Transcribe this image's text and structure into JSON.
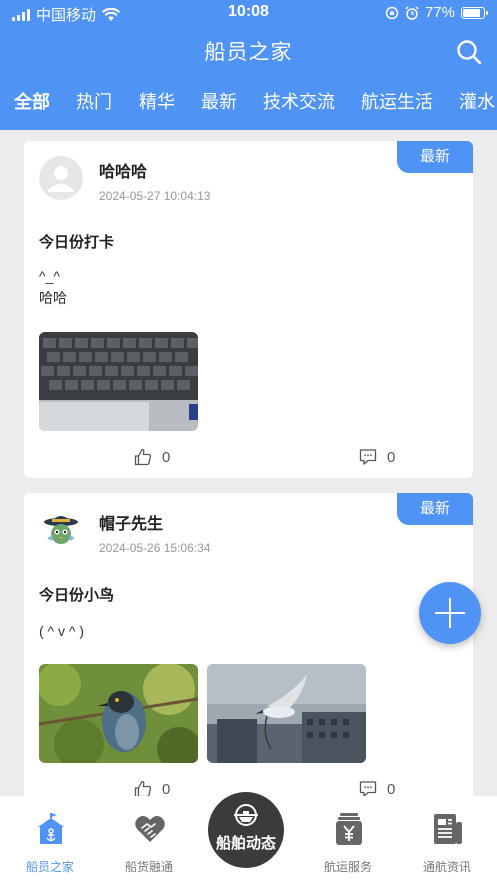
{
  "status_bar": {
    "carrier": "中国移动",
    "time": "10:08",
    "battery": "77%",
    "battery_level": 0.77
  },
  "header": {
    "title": "船员之家",
    "tabs": [
      "全部",
      "热门",
      "精华",
      "最新",
      "技术交流",
      "航运生活",
      "灌水"
    ],
    "active_tab": "全部"
  },
  "posts": [
    {
      "author": "哈哈哈",
      "date": "2024-05-27 10:04:13",
      "badge": "最新",
      "title": "今日份打卡",
      "body": "^_^\n哈哈",
      "images": [
        "keyboard-photo"
      ],
      "likes": "0",
      "comments": "0"
    },
    {
      "author": "帽子先生",
      "date": "2024-05-26 15:06:34",
      "badge": "最新",
      "title": "今日份小鸟",
      "body": "( ^ v ^ )",
      "images": [
        "heron-perched-photo",
        "heron-flying-photo"
      ],
      "likes": "0",
      "comments": "0"
    }
  ],
  "bottom_nav": {
    "items": [
      {
        "label": "船员之家",
        "icon": "home-anchor-icon",
        "active": true
      },
      {
        "label": "船货融通",
        "icon": "handshake-icon",
        "active": false
      },
      {
        "label": "船舶动态",
        "icon": "ship-icon",
        "active": false
      },
      {
        "label": "航运服务",
        "icon": "yuan-service-icon",
        "active": false
      },
      {
        "label": "通航资讯",
        "icon": "news-icon",
        "active": false
      }
    ]
  },
  "colors": {
    "primary": "#4f93f4",
    "center_nav": "#3b3b3b",
    "background": "#ececec"
  }
}
